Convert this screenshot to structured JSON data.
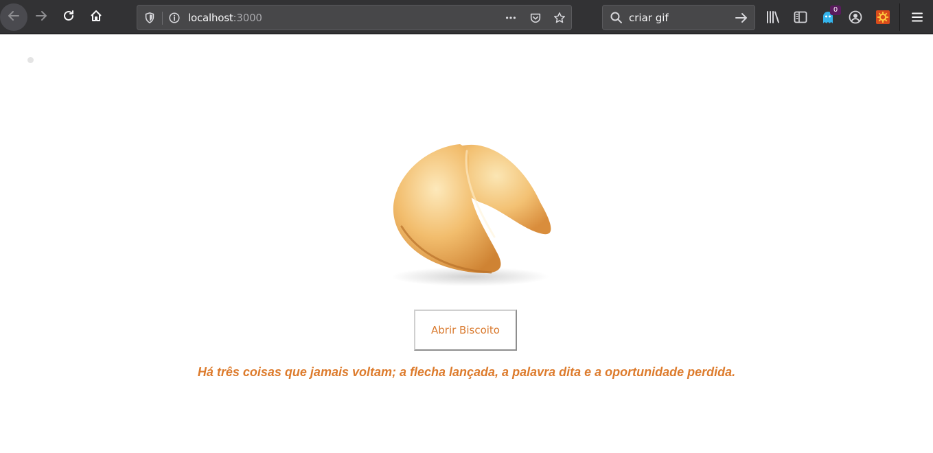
{
  "browser": {
    "url_host": "localhost",
    "url_port": ":3000",
    "search_text": "criar gif",
    "notification_count": "0",
    "icons": {
      "back": "back-arrow-icon",
      "forward": "forward-arrow-icon",
      "reload": "reload-icon",
      "home": "home-icon",
      "tracking": "shield-icon",
      "site_info": "info-icon",
      "page_actions": "more-dots-icon",
      "pocket": "pocket-icon",
      "bookmark": "star-icon",
      "search": "search-icon",
      "search_go": "arrow-right-icon",
      "library": "library-icon",
      "sidebar": "sidebar-icon",
      "ghostery": "ghost-icon",
      "account": "account-icon",
      "extension": "gear-extension-icon",
      "menu": "hamburger-menu-icon"
    }
  },
  "page": {
    "cookie_image": "fortune-cookie",
    "button_label": "Abrir Biscoito",
    "fortune": "Há três coisas que jamais voltam; a flecha lançada, a palavra dita e a oportunidade perdida.",
    "colors": {
      "accent": "#dd7b2c",
      "toolbar": "#323234"
    }
  }
}
